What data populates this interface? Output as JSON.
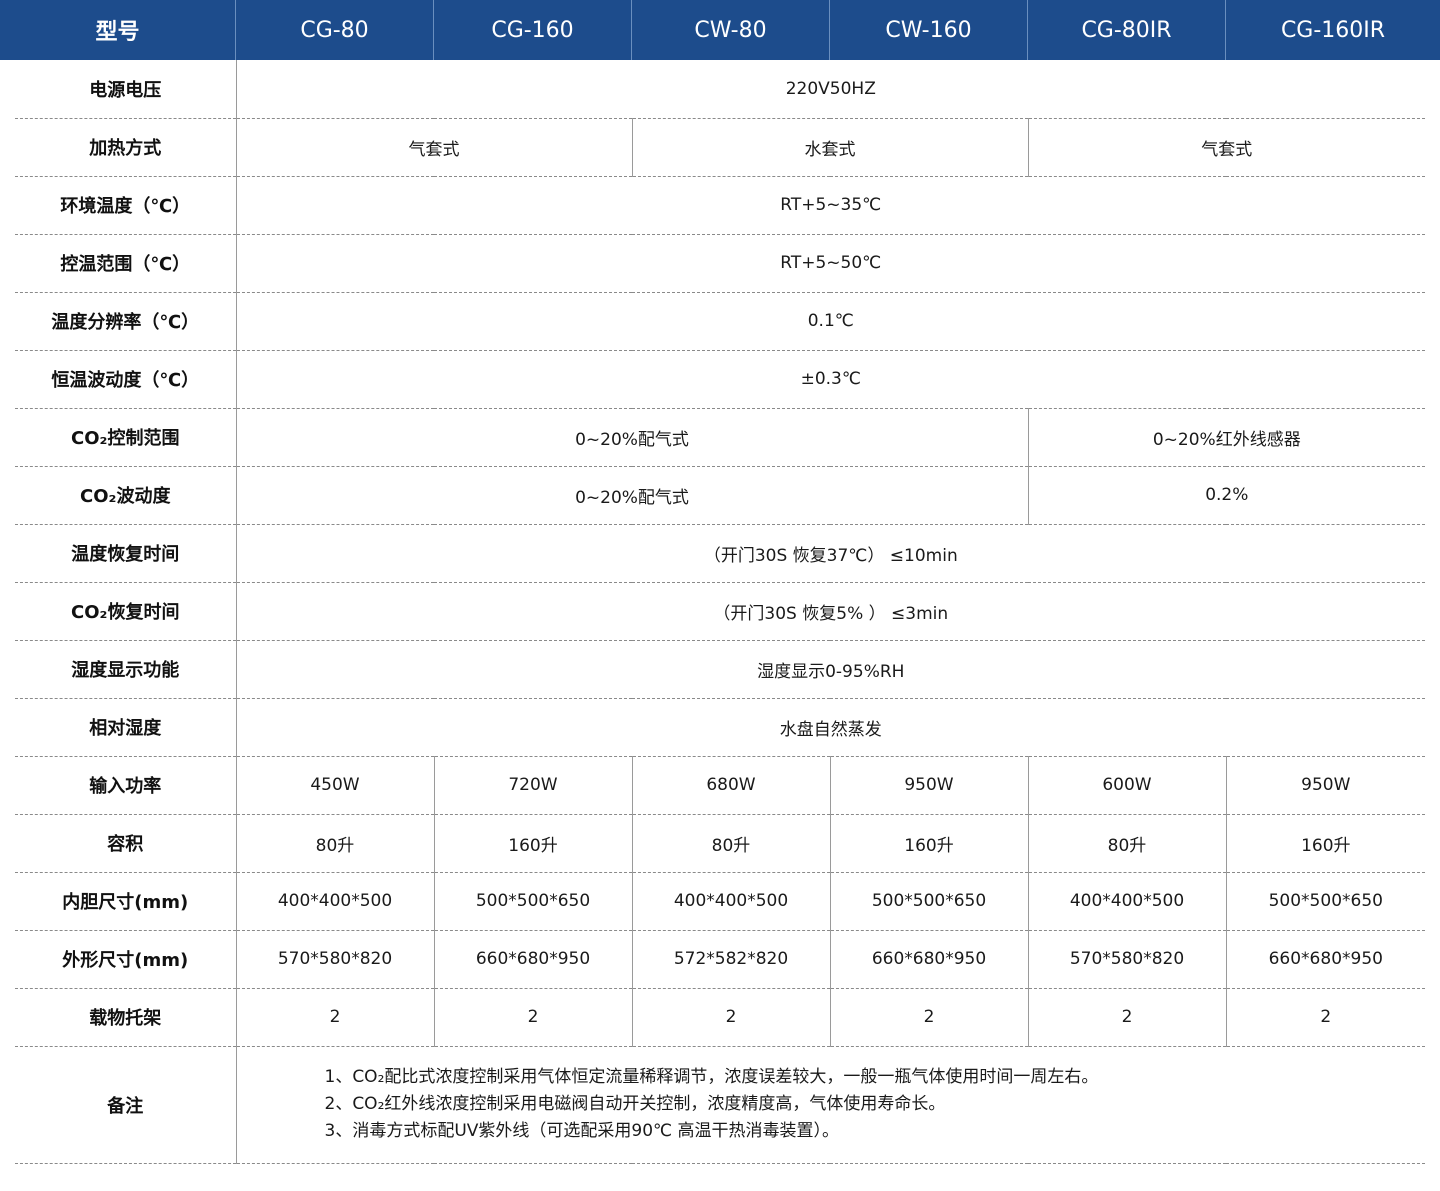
{
  "header": {
    "label": "型号",
    "models": [
      "CG-80",
      "CG-160",
      "CW-80",
      "CW-160",
      "CG-80IR",
      "CG-160IR"
    ]
  },
  "rows": {
    "power_supply": {
      "label": "电源电压",
      "value": "220V50HZ"
    },
    "heating": {
      "label": "加热方式",
      "values": [
        "气套式",
        "水套式",
        "气套式"
      ]
    },
    "ambient_temp": {
      "label": "环境温度（℃）",
      "value": "RT+5~35℃"
    },
    "temp_range": {
      "label": "控温范围（℃）",
      "value": "RT+5~50℃"
    },
    "temp_resolution": {
      "label": "温度分辨率（℃）",
      "value": "0.1℃"
    },
    "temp_fluctuation": {
      "label": "恒温波动度（℃）",
      "value": "±0.3℃"
    },
    "co2_range": {
      "label": "CO₂控制范围",
      "values": [
        "0~20%配气式",
        "0~20%红外线感器"
      ]
    },
    "co2_fluctuation": {
      "label": "CO₂波动度",
      "values": [
        "0~20%配气式",
        "0.2%"
      ]
    },
    "temp_recovery": {
      "label": "温度恢复时间",
      "value": "（开门30S 恢复37℃） ≤10min"
    },
    "co2_recovery": {
      "label": "CO₂恢复时间",
      "value": "（开门30S 恢复5% ） ≤3min"
    },
    "humidity_display": {
      "label": "湿度显示功能",
      "value": "湿度显示0-95%RH"
    },
    "relative_humidity": {
      "label": "相对湿度",
      "value": "水盘自然蒸发"
    },
    "input_power": {
      "label": "输入功率",
      "values": [
        "450W",
        "720W",
        "680W",
        "950W",
        "600W",
        "950W"
      ]
    },
    "volume": {
      "label": "容积",
      "values": [
        "80升",
        "160升",
        "80升",
        "160升",
        "80升",
        "160升"
      ]
    },
    "inner_size": {
      "label": "内胆尺寸(mm)",
      "values": [
        "400*400*500",
        "500*500*650",
        "400*400*500",
        "500*500*650",
        "400*400*500",
        "500*500*650"
      ]
    },
    "outer_size": {
      "label": "外形尺寸(mm)",
      "values": [
        "570*580*820",
        "660*680*950",
        "572*582*820",
        "660*680*950",
        "570*580*820",
        "660*680*950"
      ]
    },
    "shelves": {
      "label": "载物托架",
      "values": [
        "2",
        "2",
        "2",
        "2",
        "2",
        "2"
      ]
    }
  },
  "notes": {
    "label": "备注",
    "lines": [
      "1、CO₂配比式浓度控制采用气体恒定流量稀释调节，浓度误差较大，一般一瓶气体使用时间一周左右。",
      "2、CO₂红外线浓度控制采用电磁阀自动开关控制，浓度精度高，气体使用寿命长。",
      "3、消毒方式标配UV紫外线（可选配采用90℃ 高温干热消毒装置）。"
    ]
  },
  "colors": {
    "header_bg": "#1d4c8c",
    "header_text": "#ffffff",
    "divider": "#8a8a8a"
  }
}
